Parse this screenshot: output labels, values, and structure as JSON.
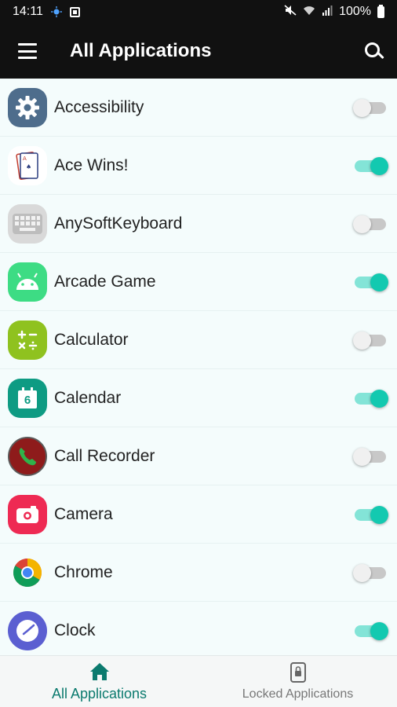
{
  "status_bar": {
    "time": "14:11",
    "battery": "100%"
  },
  "app_bar": {
    "title": "All Applications"
  },
  "apps": [
    {
      "name": "Accessibility",
      "icon": "accessibility-gear-icon",
      "enabled": false
    },
    {
      "name": "Ace Wins!",
      "icon": "playing-cards-icon",
      "enabled": true
    },
    {
      "name": "AnySoftKeyboard",
      "icon": "keyboard-icon",
      "enabled": false
    },
    {
      "name": "Arcade Game",
      "icon": "android-robot-icon",
      "enabled": true
    },
    {
      "name": "Calculator",
      "icon": "calculator-icon",
      "enabled": false
    },
    {
      "name": "Calendar",
      "icon": "calendar-icon",
      "enabled": true
    },
    {
      "name": "Call Recorder",
      "icon": "phone-recorder-icon",
      "enabled": false
    },
    {
      "name": "Camera",
      "icon": "camera-icon",
      "enabled": true
    },
    {
      "name": "Chrome",
      "icon": "chrome-icon",
      "enabled": false
    },
    {
      "name": "Clock",
      "icon": "clock-icon",
      "enabled": true
    }
  ],
  "calendar_day": "6",
  "bottom_nav": {
    "all_label": "All Applications",
    "locked_label": "Locked Applications"
  },
  "colors": {
    "accent": "#13c9b0",
    "active_nav": "#0b7a6e",
    "bar": "#111111"
  }
}
